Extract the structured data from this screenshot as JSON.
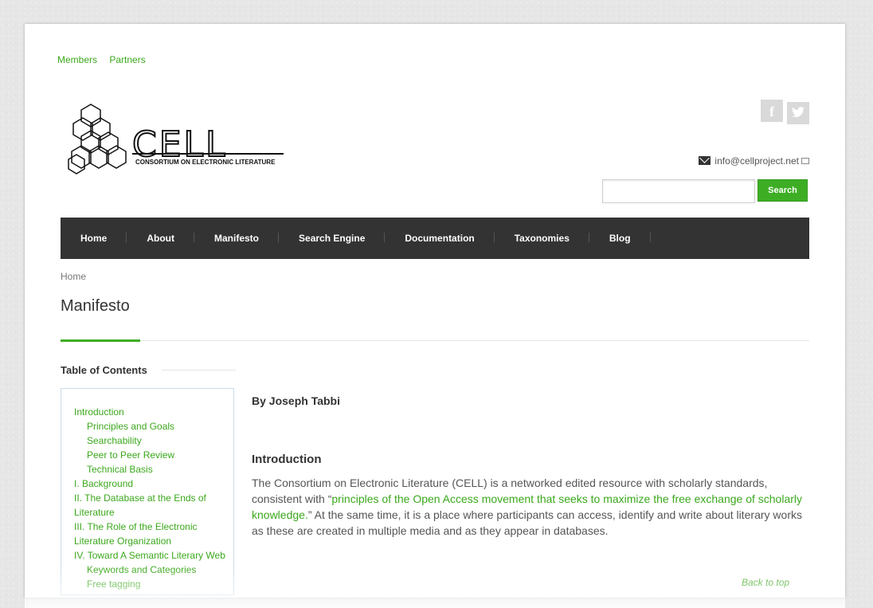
{
  "top_links": [
    "Members",
    "Partners"
  ],
  "logo": {
    "main": "CELL",
    "sub": "CONSORTIUM ON ELECTRONIC LITERATURE"
  },
  "social": {
    "facebook": "f",
    "twitter": "t"
  },
  "contact": {
    "email": "info@cellproject.net"
  },
  "search": {
    "button": "Search",
    "placeholder": ""
  },
  "nav": [
    "Home",
    "About",
    "Manifesto",
    "Search Engine",
    "Documentation",
    "Taxonomies",
    "Blog"
  ],
  "breadcrumb": "Home",
  "page_title": "Manifesto",
  "toc": {
    "heading": "Table of Contents",
    "items": [
      {
        "label": "Introduction",
        "sub": false
      },
      {
        "label": "Principles and Goals",
        "sub": true
      },
      {
        "label": "Searchability",
        "sub": true
      },
      {
        "label": "Peer to Peer Review",
        "sub": true
      },
      {
        "label": "Technical Basis",
        "sub": true
      },
      {
        "label": "I. Background",
        "sub": false
      },
      {
        "label": "II. The Database at the Ends of Literature",
        "sub": false
      },
      {
        "label": "III. The Role of the Electronic Literature Organization",
        "sub": false
      },
      {
        "label": "IV. Toward A Semantic Literary Web",
        "sub": false
      },
      {
        "label": "Keywords and Categories",
        "sub": true
      },
      {
        "label": "Free tagging",
        "sub": true
      }
    ]
  },
  "article": {
    "byline": "By Joseph Tabbi",
    "intro_heading": "Introduction",
    "intro_before": "The Consortium on Electronic Literature (CELL) is a networked edited resource with scholarly standards, consistent with “",
    "intro_link": "principles of the Open Access movement that seeks to maximize the free exchange of scholarly knowledge.",
    "intro_after": "” At the same time, it is a place where participants can access, identify and write about literary works as these are created in multiple media and as they appear in databases.",
    "back_to_top": "Back to top"
  }
}
